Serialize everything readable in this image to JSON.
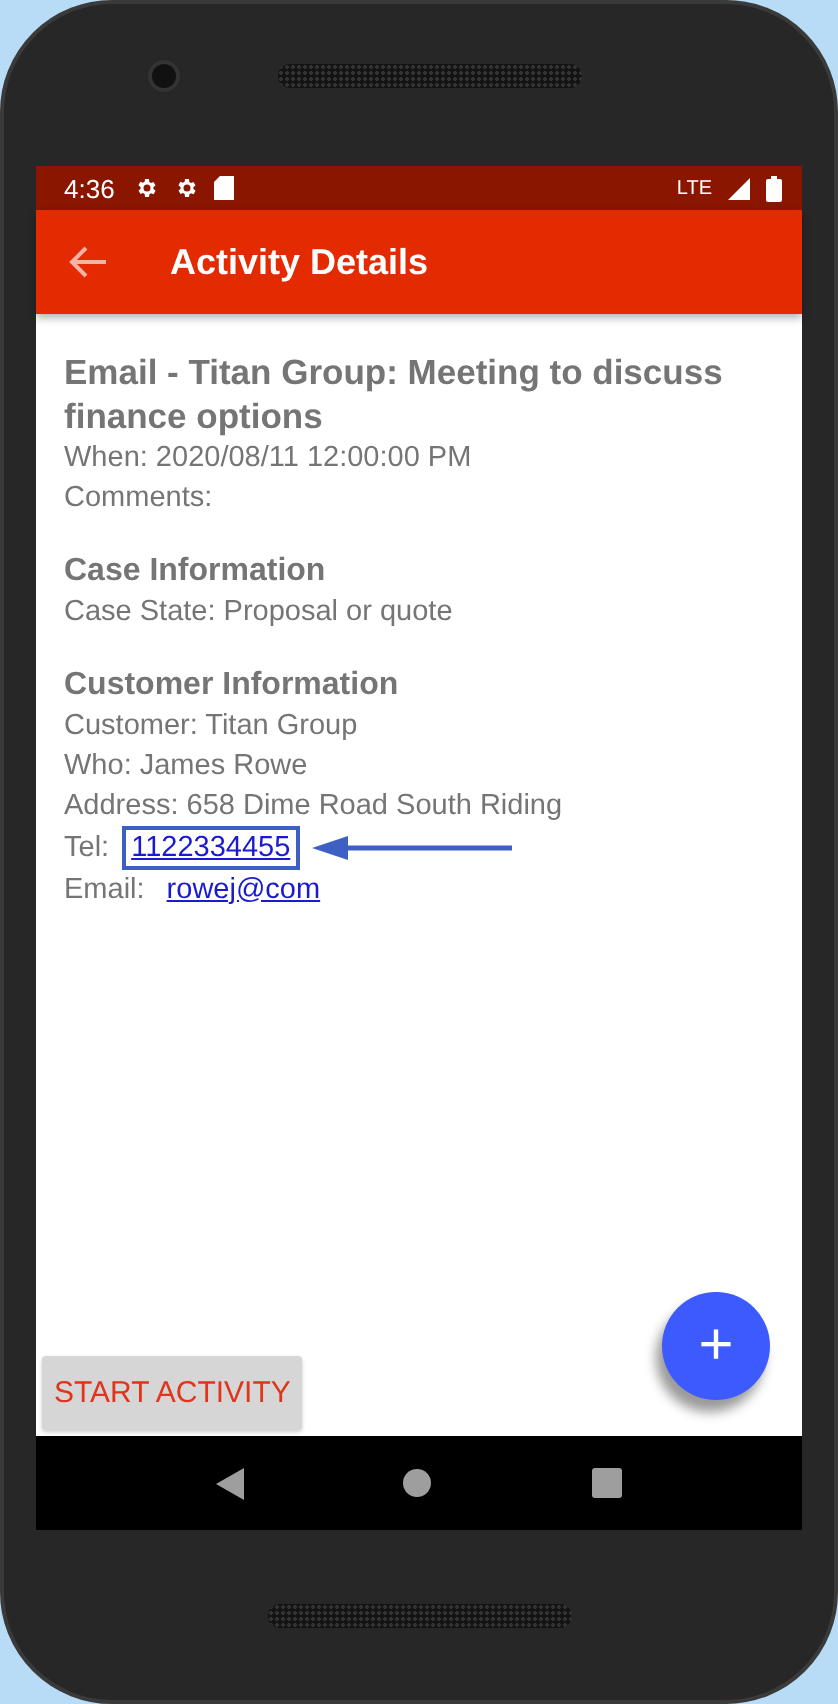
{
  "status_bar": {
    "time": "4:36",
    "network": "LTE"
  },
  "app_bar": {
    "title": "Activity Details"
  },
  "activity": {
    "title": "Email - Titan Group: Meeting to discuss finance options",
    "lines": [
      {
        "kind": "text",
        "text": "When: 2020/08/11 12:00:00 PM"
      },
      {
        "kind": "text",
        "text": "Comments:"
      }
    ]
  },
  "sections": [
    {
      "heading": "Case Information",
      "lines": [
        {
          "kind": "text",
          "text": "Case State: Proposal or quote"
        }
      ]
    },
    {
      "heading": "Customer Information",
      "lines": [
        {
          "kind": "text",
          "text": "Customer: Titan Group"
        },
        {
          "kind": "text",
          "text": "Who: James Rowe"
        },
        {
          "kind": "text",
          "text": "Address: 658 Dime Road South Riding"
        },
        {
          "kind": "link",
          "label": "Tel:",
          "link": "1122334455",
          "highlighted": true
        },
        {
          "kind": "link",
          "label": "Email:",
          "link": "rowej@com",
          "highlighted": false
        }
      ]
    }
  ],
  "start_button": {
    "label": "START ACTIVITY"
  },
  "fab": {
    "label": "+"
  }
}
